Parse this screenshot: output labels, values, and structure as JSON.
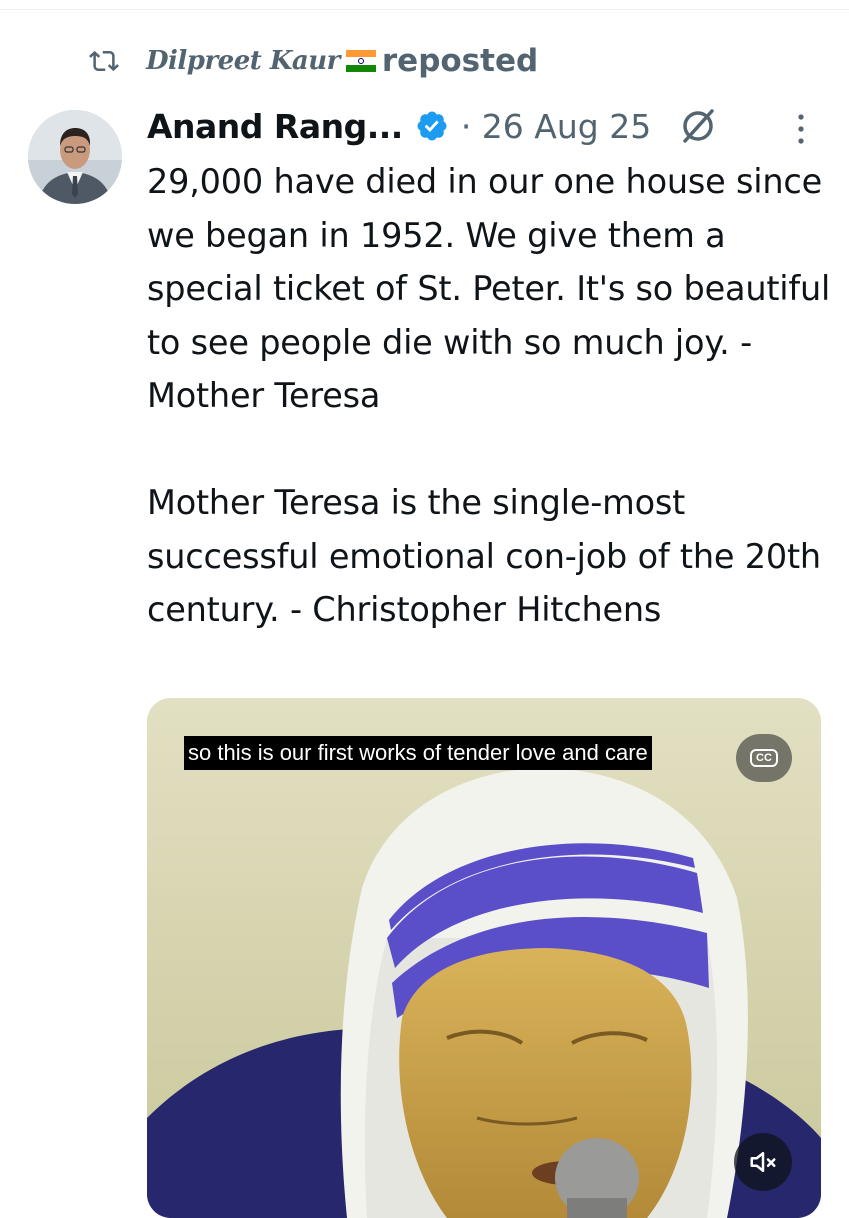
{
  "repost": {
    "icon": "repost-icon",
    "reposter_name": "Dilpreet Kaur",
    "flag": "india-flag-icon",
    "label": "reposted"
  },
  "post": {
    "author": "Anand Rang...",
    "verified": "verified-badge-icon",
    "dot_date": "· 26 Aug 25",
    "text": "29,000 have died in our one house since we began in 1952. We give them a special ticket of St. Peter. It's so beautiful to see people die with so much joy. - Mother Teresa\n\nMother Teresa is the single-most successful emotional con-job of the 20th century. - Christopher Hitchens"
  },
  "media": {
    "subtitle": "so this is our first works of tender love and care",
    "cc_label": "CC",
    "mute_icon": "volume-muted-icon"
  },
  "colors": {
    "text_primary": "#0f1419",
    "text_secondary": "#536471",
    "verified_blue": "#1d9bf0",
    "habit_blue": "#5a4fc8"
  }
}
